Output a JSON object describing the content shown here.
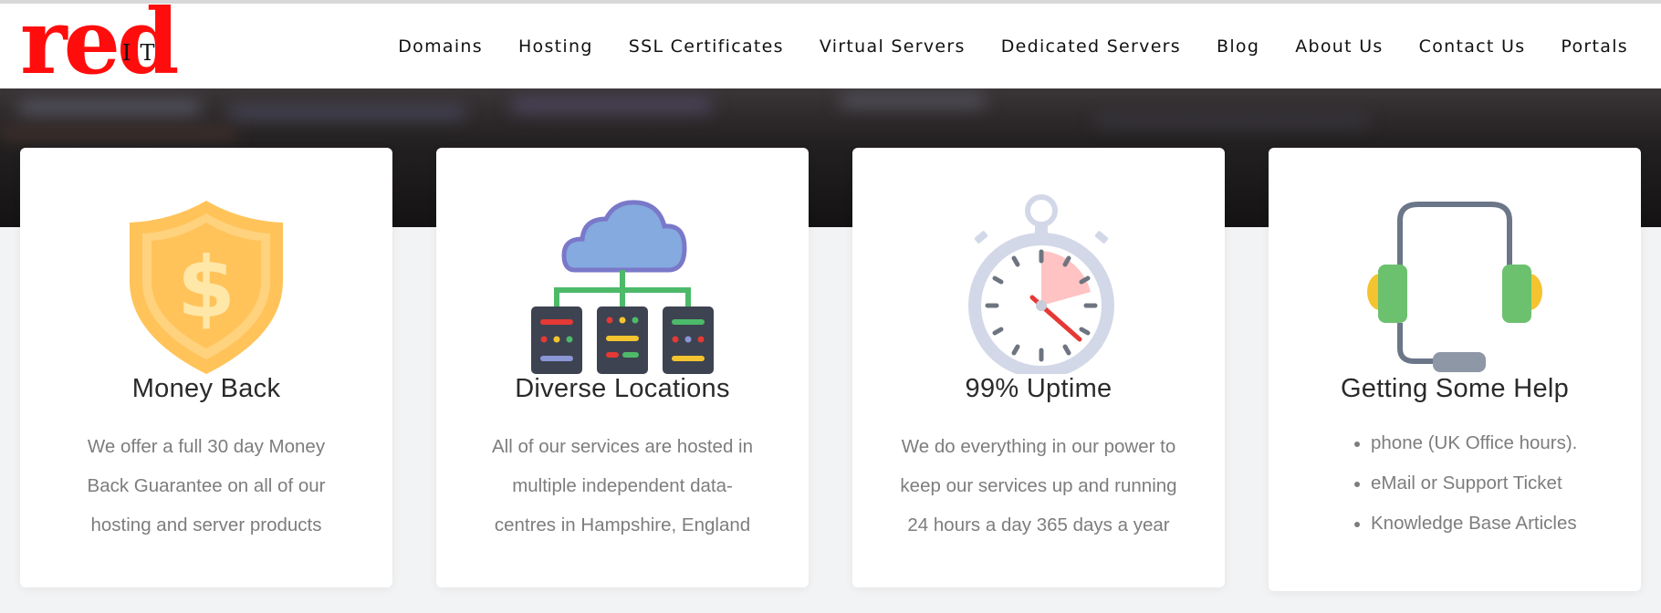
{
  "logo": {
    "main": "red",
    "sub": "IT"
  },
  "nav": [
    "Domains",
    "Hosting",
    "SSL Certificates",
    "Virtual Servers",
    "Dedicated Servers",
    "Blog",
    "About Us",
    "Contact Us",
    "Portals"
  ],
  "features": {
    "money_back": {
      "icon": "shield-dollar-icon",
      "title": "Money Back",
      "text": "We offer a full 30 day Money Back Guarantee on all of our hosting and server products"
    },
    "locations": {
      "icon": "cloud-servers-icon",
      "title": "Diverse Locations",
      "text": "All of our services are hosted in multiple independent data-centres in Hampshire, England"
    },
    "uptime": {
      "icon": "stopwatch-icon",
      "title": "99% Uptime",
      "text": "We do everything in our power to keep our services up and running 24 hours a day 365 days a year"
    },
    "help": {
      "icon": "headset-icon",
      "title": "Getting Some Help",
      "items": [
        "phone (UK Office hours).",
        "eMail or Support Ticket",
        "Knowledge Base Articles"
      ]
    }
  },
  "colors": {
    "brand_red": "#ff0d0d",
    "header_bg": "#ffffff",
    "hero_bg": "#1c1a1b",
    "card_bg": "#ffffff",
    "title_text": "#2a2a2a",
    "body_text": "#7d7d7d"
  }
}
